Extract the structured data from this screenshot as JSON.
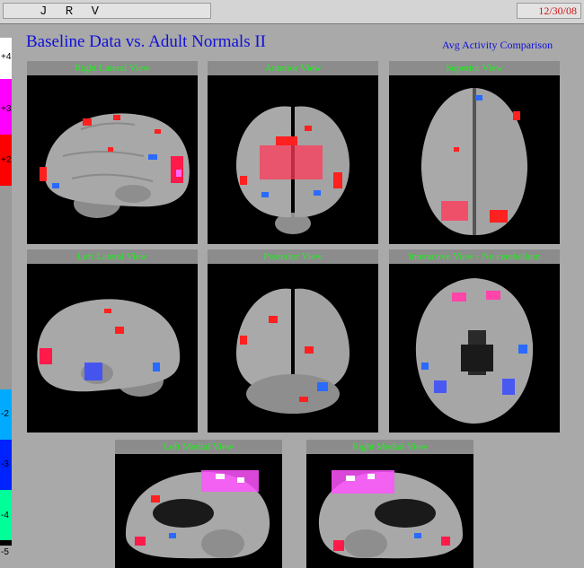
{
  "header": {
    "patient_id": "J R V",
    "date": "12/30/08"
  },
  "title": "Baseline Data vs. Adult Normals II",
  "subtitle": "Avg Activity Comparison",
  "scale": {
    "ticks": [
      "+4",
      "+3",
      "+2",
      "-2",
      "-3",
      "-4",
      "-5"
    ],
    "colors": {
      "plus4": "#ffffff",
      "plus3": "#ff00ff",
      "plus2": "#ff0000",
      "neutral": "#999999",
      "minus2": "#00aaff",
      "minus3": "#0022ff",
      "minus4": "#00ff99"
    }
  },
  "views": {
    "right_lateral": "Right Lateral View",
    "anterior": "Anterior View",
    "superior": "Superior View",
    "left_lateral": "Left Lateral View",
    "posterior": "Posterior View",
    "interactive": "Interactive View - No cerebellum",
    "left_medial": "Left Medial View",
    "right_medial": "Right Medial View"
  }
}
